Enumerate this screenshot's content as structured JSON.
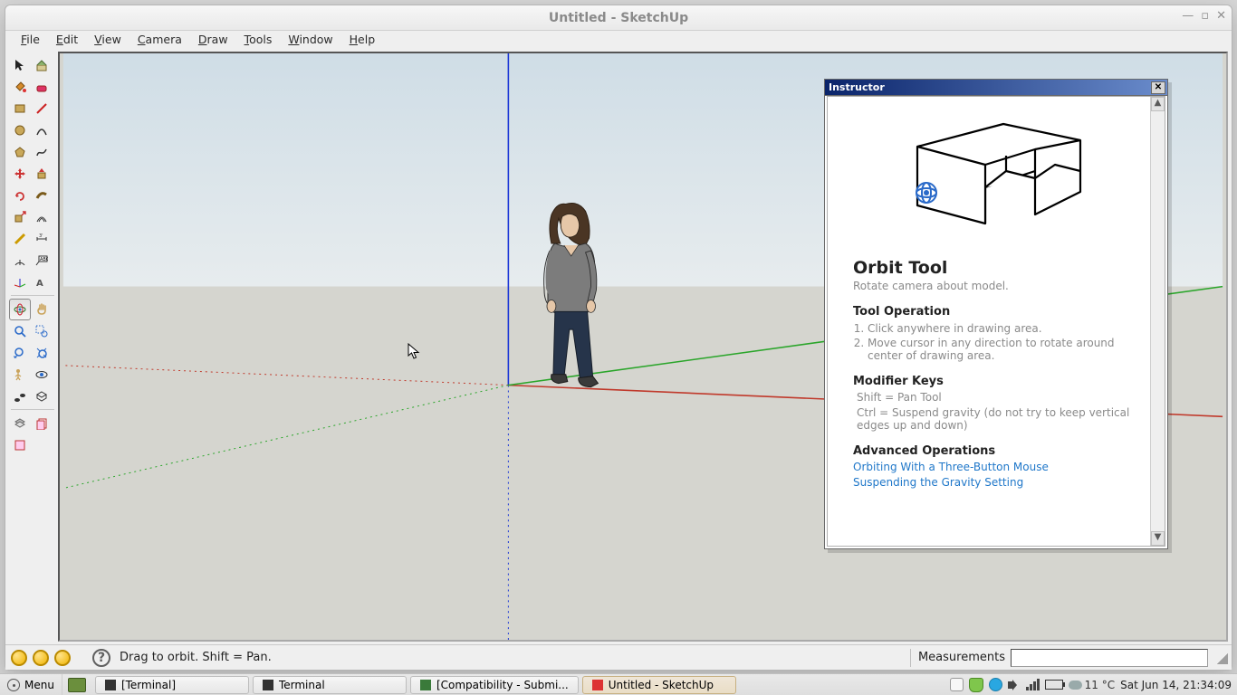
{
  "window": {
    "title": "Untitled - SketchUp"
  },
  "menubar": {
    "items": [
      "File",
      "Edit",
      "View",
      "Camera",
      "Draw",
      "Tools",
      "Window",
      "Help"
    ]
  },
  "toolbar": {
    "rows": [
      [
        "select",
        "eraser"
      ],
      [
        "line",
        "freehand"
      ],
      [
        "rectangle",
        "arc"
      ],
      [
        "circle",
        "polygon"
      ],
      [
        "rotrect",
        "offset"
      ],
      [
        "pushpull",
        "followme"
      ],
      [
        "move",
        "rotate"
      ],
      [
        "scale",
        "tape"
      ],
      [
        "paint",
        "text"
      ],
      [
        "dimension",
        "axes"
      ],
      [
        "orbit",
        "pan"
      ],
      [
        "zoom",
        "zoomwin"
      ],
      [
        "prev",
        "next"
      ],
      [
        "position",
        "lookaround"
      ],
      [
        "walk",
        "section"
      ]
    ],
    "extra": [
      [
        "plan",
        "model"
      ],
      [
        "outliner",
        ""
      ]
    ],
    "selected": "orbit"
  },
  "statusbar": {
    "help_icon": "?",
    "message": "Drag to orbit.  Shift = Pan.",
    "measurements_label": "Measurements",
    "measurements_value": ""
  },
  "instructor": {
    "title": "Instructor",
    "heading": "Orbit Tool",
    "subtitle": "Rotate camera about model.",
    "operation_label": "Tool Operation",
    "steps": [
      "Click anywhere in drawing area.",
      "Move cursor in any direction to rotate around center of drawing area."
    ],
    "modifier_label": "Modifier Keys",
    "modifier_lines": [
      "Shift = Pan Tool",
      "Ctrl = Suspend gravity (do not try to keep vertical edges up and down)"
    ],
    "advanced_label": "Advanced Operations",
    "advanced_links": [
      "Orbiting With a Three-Button Mouse",
      "Suspending the Gravity Setting"
    ]
  },
  "osbar": {
    "menu_label": "Menu",
    "tasks": [
      {
        "label": "[Terminal]",
        "active": false
      },
      {
        "label": "Terminal",
        "active": false
      },
      {
        "label": "[Compatibility - Submi...",
        "active": false
      },
      {
        "label": "Untitled - SketchUp",
        "active": true
      }
    ],
    "weather": "11 °C",
    "datetime": "Sat Jun 14, 21:34:09"
  }
}
